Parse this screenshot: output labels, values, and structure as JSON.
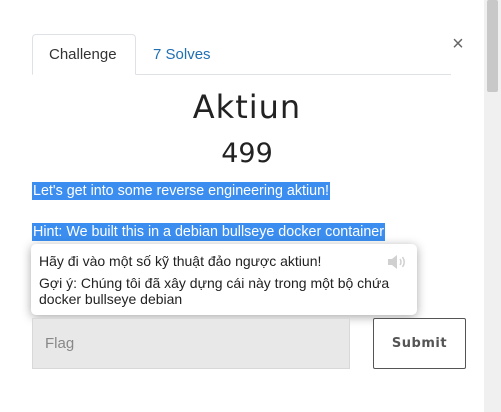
{
  "tabs": [
    {
      "label": "Challenge"
    },
    {
      "label": "7 Solves"
    }
  ],
  "close_label": "×",
  "challenge": {
    "name": "Aktiun",
    "points": "499",
    "description": "Let's get into some reverse engineering aktiun!",
    "hint": "Hint: We built this in a debian bullseye docker container"
  },
  "translation_popup": {
    "line1": "Hãy đi vào một số kỹ thuật đảo ngược aktiun!",
    "line2": "Gợi ý: Chúng tôi đã xây dựng cái này trong một bộ chứa docker bullseye debian"
  },
  "form": {
    "flag_placeholder": "Flag",
    "submit_label": "Submit"
  },
  "colors": {
    "highlight": "#3b8ef0",
    "link": "#1f6fb2"
  }
}
